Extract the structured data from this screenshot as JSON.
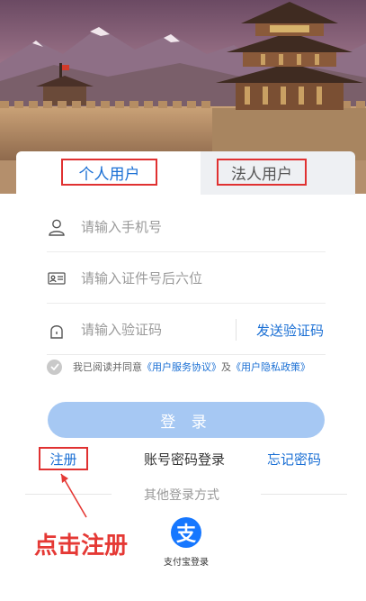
{
  "tabs": {
    "personal": "个人用户",
    "legal": "法人用户"
  },
  "form": {
    "phone_placeholder": "请输入手机号",
    "id_placeholder": "请输入证件号后六位",
    "code_placeholder": "请输入验证码",
    "send_code": "发送验证码"
  },
  "agreement": {
    "prefix": "我已阅读并同意",
    "service_link": "《用户服务协议》",
    "and": "及",
    "privacy_link": "《用户隐私政策》"
  },
  "actions": {
    "login": "登 录",
    "register": "注册",
    "password_login": "账号密码登录",
    "forgot": "忘记密码"
  },
  "other": {
    "label": "其他登录方式",
    "alipay_icon": "alipay-icon",
    "alipay_logo_char": "支",
    "alipay_label": "支付宝登录"
  },
  "annotation": {
    "text": "点击注册"
  },
  "colors": {
    "accent": "#1a6fd4",
    "button_disabled": "#a6c8f3",
    "highlight": "#e03131"
  }
}
